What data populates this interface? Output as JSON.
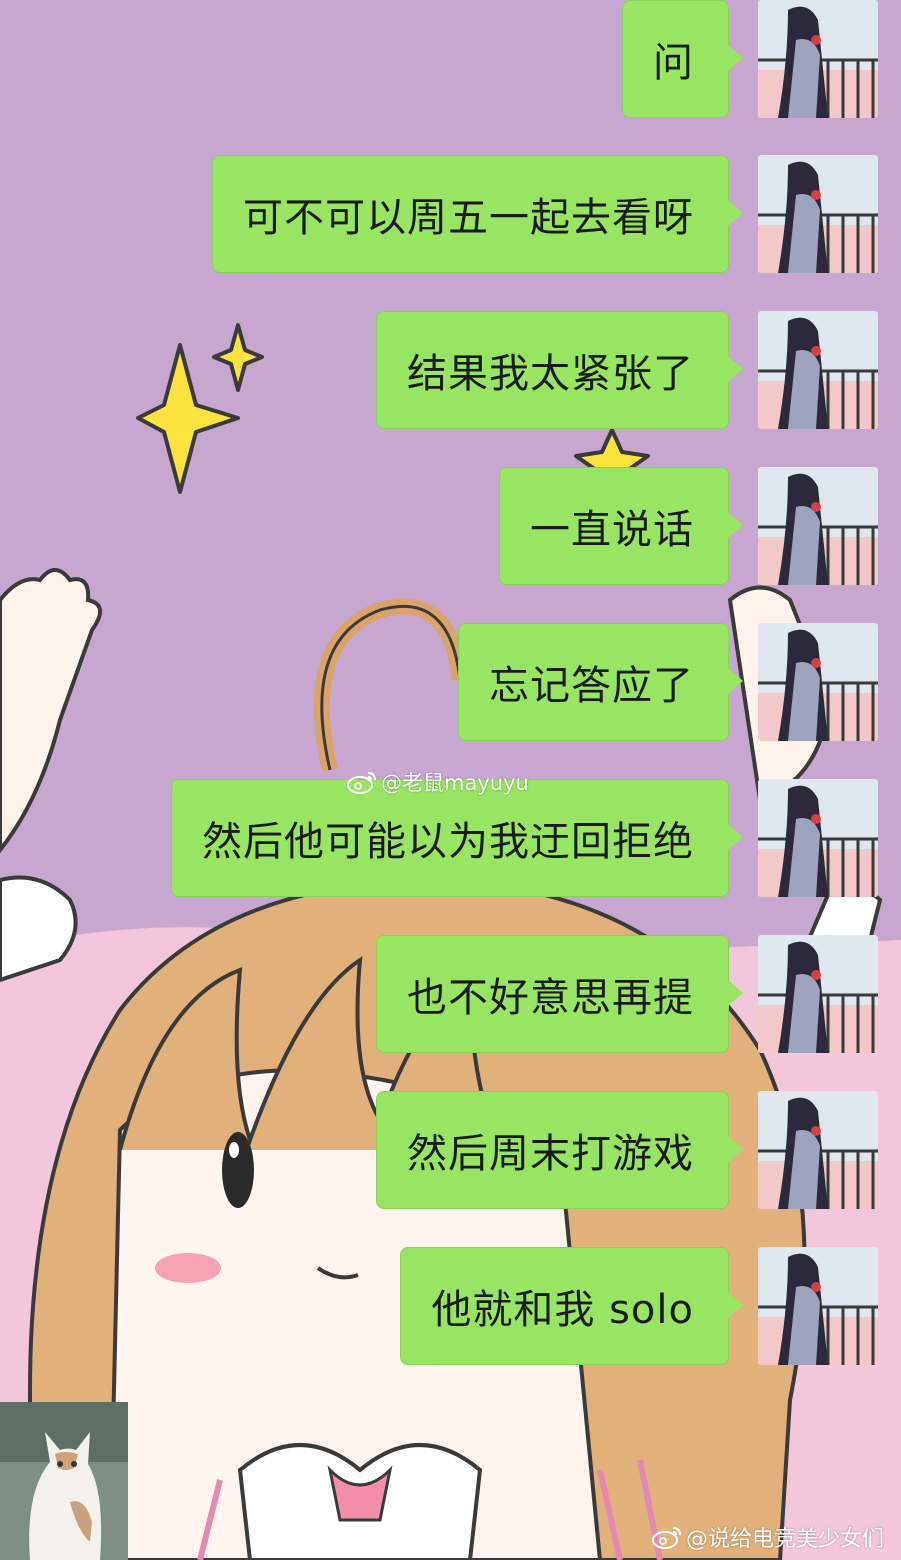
{
  "chat": {
    "messages": [
      {
        "text": "问",
        "sender": "self"
      },
      {
        "text": "可不可以周五一起去看呀",
        "sender": "self"
      },
      {
        "text": "结果我太紧张了",
        "sender": "self"
      },
      {
        "text": "一直说话",
        "sender": "self"
      },
      {
        "text": "忘记答应了",
        "sender": "self"
      },
      {
        "text": "然后他可能以为我迂回拒绝",
        "sender": "self"
      },
      {
        "text": "也不好意思再提",
        "sender": "self"
      },
      {
        "text": "然后周末打游戏",
        "sender": "self"
      },
      {
        "text": "他就和我 solo",
        "sender": "self"
      }
    ],
    "bubble_color": "#97e563",
    "background_color": "#c7a6cf"
  },
  "watermarks": {
    "top": "@老鼠mayuyu",
    "bottom": "@说给电竞美少女们",
    "icon": "weibo-icon"
  },
  "avatars": {
    "self": "anime-girl-avatar",
    "other": "cat-avatar"
  }
}
